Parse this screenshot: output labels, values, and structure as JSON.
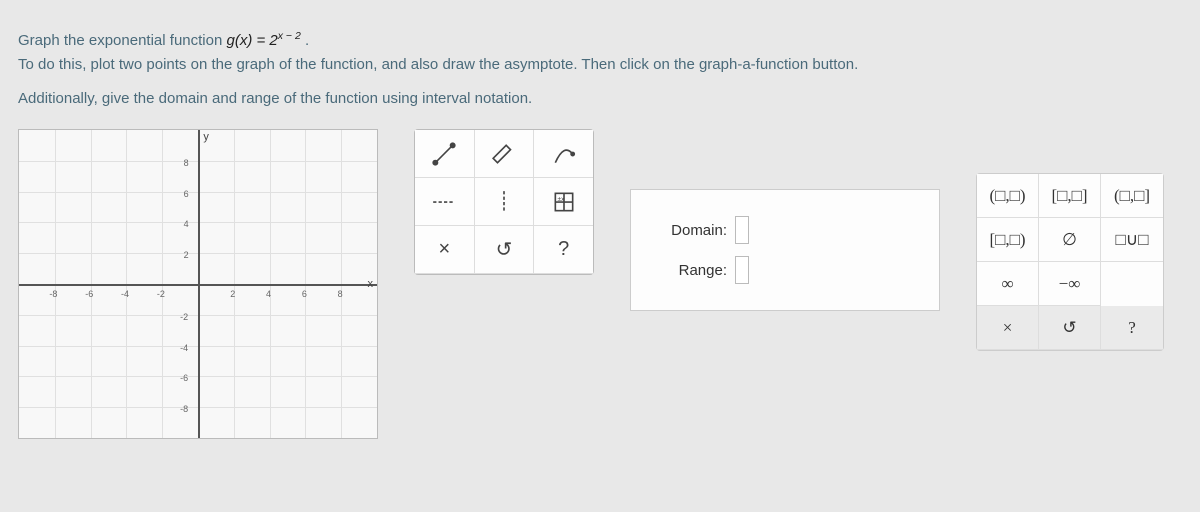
{
  "instructions": {
    "line1_pre": "Graph the exponential function ",
    "fn_lhs": "g",
    "fn_var": "(x)",
    "fn_eq": " = 2",
    "fn_exp": "x − 2",
    "line1_post": ".",
    "line2": "To do this, plot two points on the graph of the function, and also draw the asymptote. Then click on the graph-a-function button.",
    "line3": "Additionally, give the domain and range of the function using interval notation."
  },
  "graph": {
    "y_label": "y",
    "x_label": "x",
    "x_ticks": [
      "-8",
      "-6",
      "-4",
      "-2",
      "2",
      "4",
      "6",
      "8"
    ],
    "y_ticks": [
      "8",
      "6",
      "4",
      "2",
      "-2",
      "-4",
      "-6",
      "-8"
    ]
  },
  "toolbox": {
    "line_tool": "line",
    "pencil_tool": "pencil",
    "curve_tool": "curve",
    "h_asymptote_tool": "h-asymptote",
    "v_asymptote_tool": "v-asymptote",
    "graph_fn_tool": "graph-function",
    "clear": "×",
    "reset": "↺",
    "help": "?"
  },
  "domain_range": {
    "domain_label": "Domain:",
    "range_label": "Range:"
  },
  "palette": {
    "open_open": "(□,□)",
    "closed_closed": "[□,□]",
    "open_closed": "(□,□]",
    "closed_open": "[□,□)",
    "empty_set": "∅",
    "union": "□∪□",
    "infinity": "∞",
    "neg_infinity": "−∞",
    "clear": "×",
    "reset": "↺",
    "help": "?"
  }
}
